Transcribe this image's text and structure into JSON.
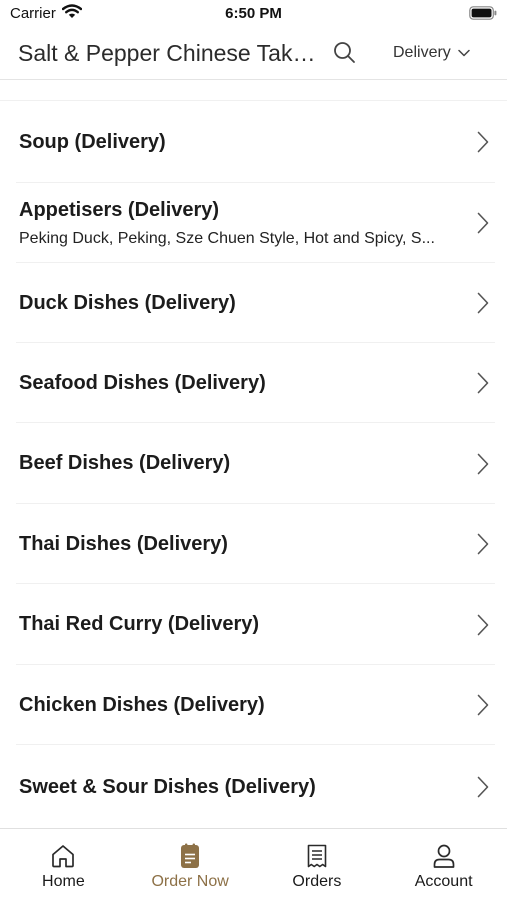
{
  "status_bar": {
    "carrier": "Carrier",
    "time": "6:50 PM"
  },
  "header": {
    "title": "Salt & Pepper Chinese Takeaway",
    "search_icon": "search-icon",
    "order_type": "Delivery"
  },
  "menu": {
    "categories": [
      {
        "title": "Soup (Delivery)",
        "subtitle": ""
      },
      {
        "title": "Appetisers (Delivery)",
        "subtitle": "Peking Duck, Peking, Sze Chuen Style, Hot and Spicy, S..."
      },
      {
        "title": "Duck Dishes (Delivery)",
        "subtitle": ""
      },
      {
        "title": "Seafood Dishes (Delivery)",
        "subtitle": ""
      },
      {
        "title": "Beef Dishes (Delivery)",
        "subtitle": ""
      },
      {
        "title": "Thai Dishes (Delivery)",
        "subtitle": ""
      },
      {
        "title": "Thai Red Curry (Delivery)",
        "subtitle": ""
      },
      {
        "title": "Chicken Dishes (Delivery)",
        "subtitle": ""
      },
      {
        "title": "Sweet & Sour Dishes (Delivery)",
        "subtitle": ""
      }
    ]
  },
  "tab_bar": {
    "active_color": "#8d7147",
    "tabs": [
      {
        "label": "Home",
        "icon": "home-icon"
      },
      {
        "label": "Order Now",
        "icon": "order-bag-icon",
        "active": true
      },
      {
        "label": "Orders",
        "icon": "receipt-icon"
      },
      {
        "label": "Account",
        "icon": "account-icon"
      }
    ]
  }
}
